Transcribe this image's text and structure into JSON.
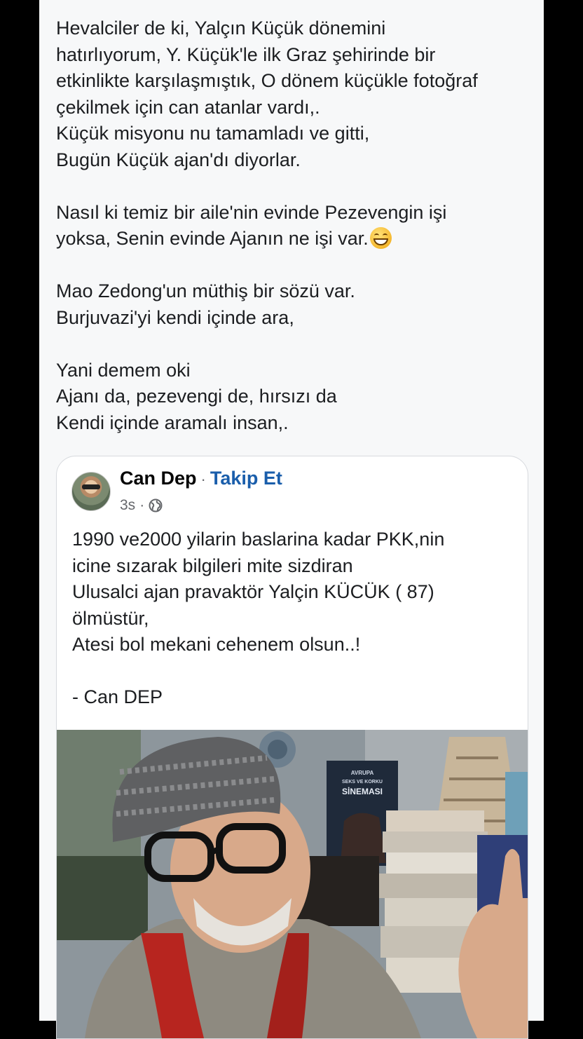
{
  "post": {
    "lines": [
      "Hevalciler de ki, Yalçın Küçük dönemini",
      "hatırlıyorum, Y. Küçük'le ilk Graz şehirinde bir",
      "etkinlikte karşılaşmıştık, O dönem küçükle fotoğraf",
      "çekilmek için can atanlar vardı,.",
      "Küçük misyonu nu tamamladı ve gitti,",
      "Bugün Küçük ajan'dı diyorlar.",
      "",
      "Nasıl ki temiz bir aile'nin evinde Pezevengin işi",
      "yoksa, Senin evinde Ajanın ne işi var.",
      "",
      "Mao Zedong'un müthiş bir sözü var.",
      "Burjuvazi'yi kendi içinde ara,",
      "",
      "Yani demem oki",
      "Ajanı da, pezevengi de, hırsızı da",
      "Kendi içinde aramalı insan,."
    ],
    "emoji_icon": "grinning-face-icon"
  },
  "shared": {
    "author": "Can Dep",
    "separator": "·",
    "follow_label": "Takip Et",
    "time": "3s",
    "meta_separator": "·",
    "privacy_icon": "globe-icon",
    "lines": [
      "1990 ve2000 yilarin baslarina kadar  PKK,nin",
      "icine sızarak bilgileri mite sizdiran",
      "Ulusalci ajan pravaktör Yalçin KÜCÜK ( 87)",
      "ölmüstür,",
      "Atesi bol mekani cehenem olsun..!",
      "",
      "- Can DEP"
    ],
    "photo_book_title": "AVRUPA SEKS VE KORKU SİNEMASI"
  },
  "colors": {
    "follow": "#1a5eab",
    "text": "#1c1e21",
    "meta": "#65676b"
  }
}
